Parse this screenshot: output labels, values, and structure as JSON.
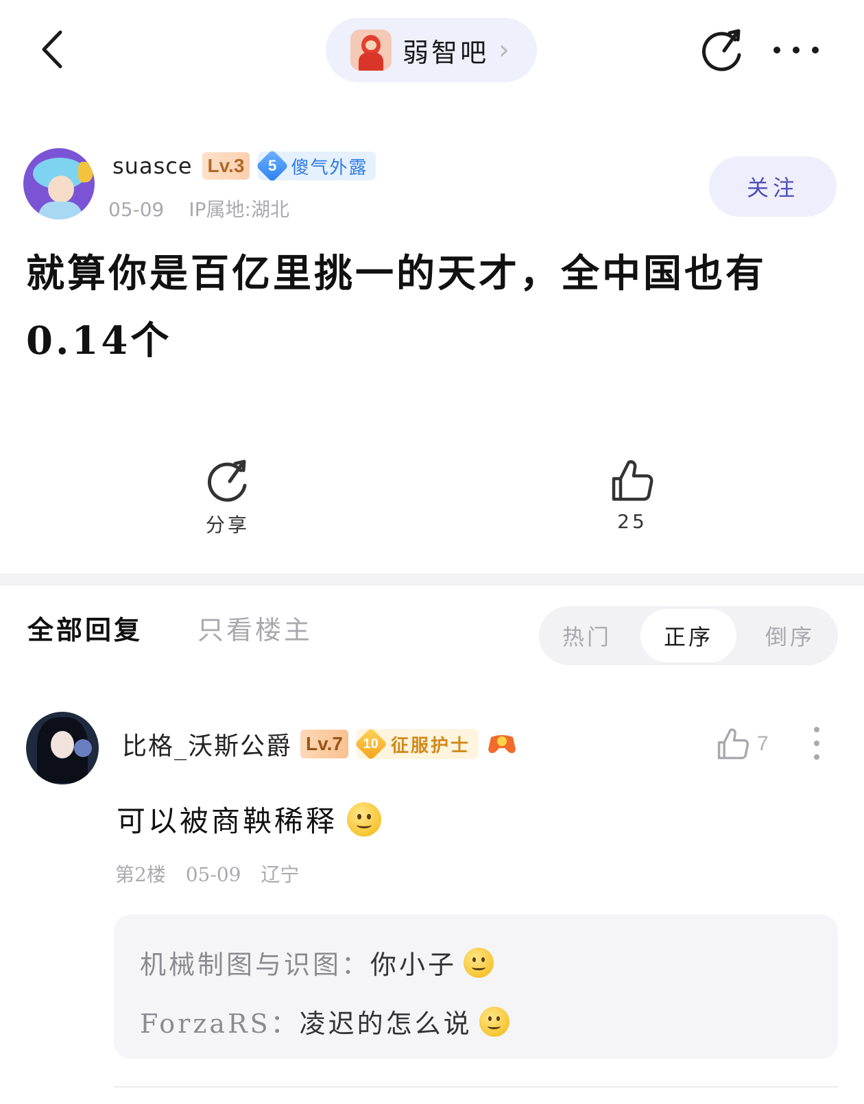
{
  "topbar": {
    "forum_name": "弱智吧",
    "forum_chevron": "›"
  },
  "author": {
    "name": "suasce",
    "level": "Lv.3",
    "title_level": "5",
    "title_text": "傻气外露",
    "date": "05-09",
    "ip": "IP属地:湖北",
    "follow_label": "关注"
  },
  "post": {
    "text": "就算你是百亿里挑一的天才，全中国也有0.14个"
  },
  "actions": {
    "share_label": "分享",
    "like_count": "25"
  },
  "reply_tabs": {
    "all": "全部回复",
    "only_op": "只看楼主",
    "sort": [
      "热门",
      "正序",
      "倒序"
    ]
  },
  "comment": {
    "name": "比格_沃斯公爵",
    "level": "Lv.7",
    "title_level": "10",
    "title_text": "征服护士",
    "like_count": "7",
    "text": "可以被商鞅稀释",
    "floor": "第2楼",
    "date": "05-09",
    "region": "辽宁",
    "replies": [
      {
        "user": "机械制图与识图：",
        "text": "你小子",
        "emoji": "thinking-emoji"
      },
      {
        "user": "ForzaRS：",
        "text": "凌迟的怎么说",
        "emoji": "smile-emoji"
      }
    ]
  },
  "colors": {
    "accent": "#4f4fb8",
    "pill_bg": "#eef0fb",
    "muted": "#a9a9b0"
  }
}
